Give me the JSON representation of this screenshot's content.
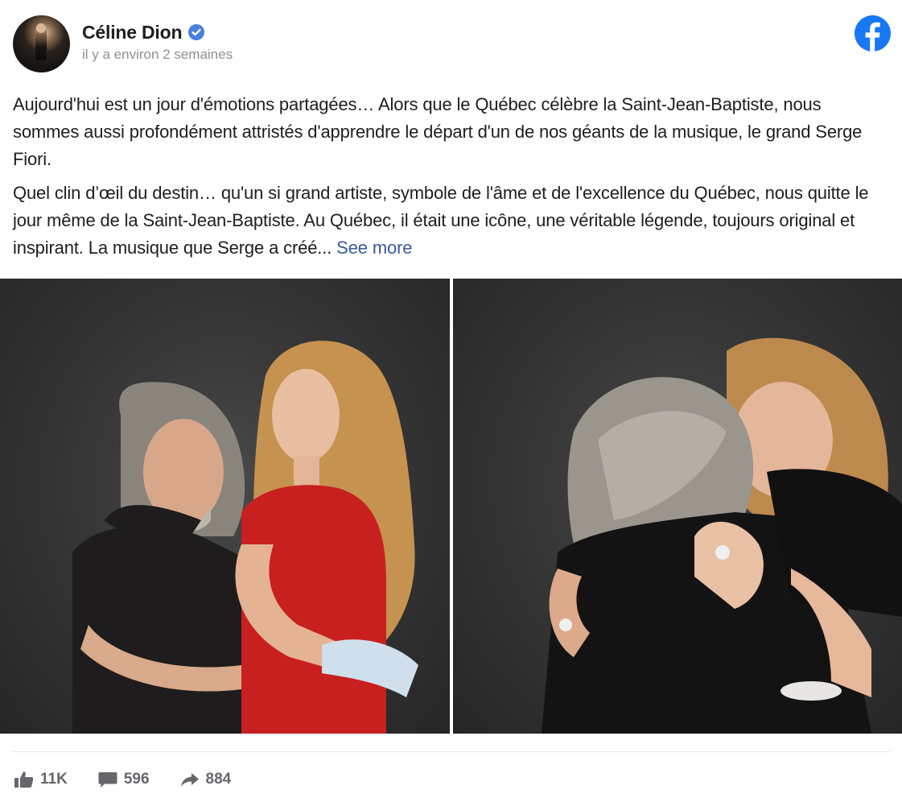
{
  "post": {
    "author": "Céline Dion",
    "timestamp": "il y a environ 2 semaines",
    "paragraphs": [
      "Aujourd'hui est un jour d'émotions partagées… Alors que le Québec célèbre la Saint-Jean-Baptiste, nous sommes aussi profondément attristés d'apprendre le départ d'un de nos géants de la musique, le grand Serge Fiori.",
      "Quel clin d’œil du destin… qu'un si grand artiste, symbole de l'âme et de l'excellence du Québec, nous quitte le jour même de la Saint-Jean-Baptiste. Au Québec, il était une icône, une véritable légende, toujours original et inspirant. La musique que Serge a créé..."
    ],
    "see_more": "See more"
  },
  "icons": {
    "verified": "verified-badge-icon",
    "platform": "facebook-icon",
    "like": "thumbs-up-icon",
    "comment": "comment-icon",
    "share": "share-arrow-icon"
  },
  "stats": {
    "likes": "11K",
    "comments": "596",
    "shares": "884"
  },
  "colors": {
    "facebook_blue": "#1877f2",
    "verified_blue": "#3b82f6",
    "link": "#3b5998",
    "muted": "#65676b"
  }
}
